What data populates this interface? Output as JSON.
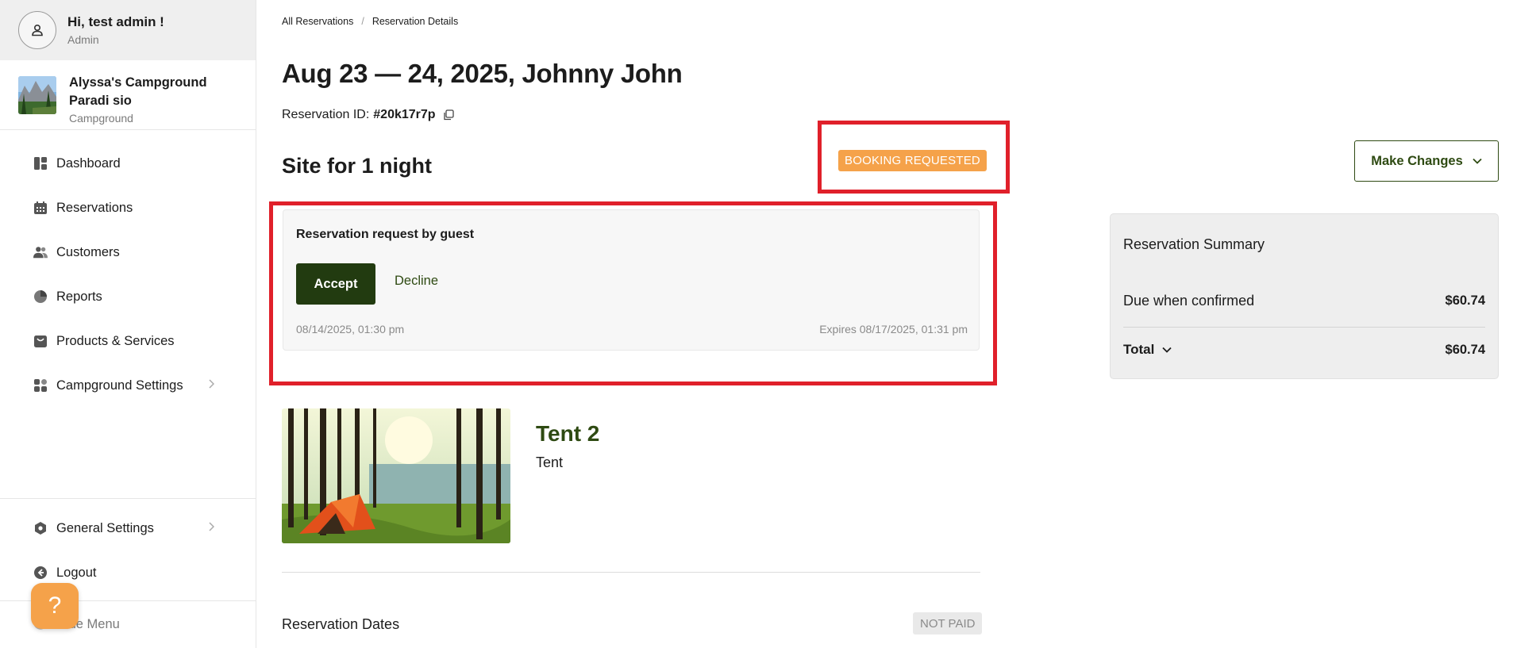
{
  "user": {
    "greeting": "Hi, test admin !",
    "role": "Admin"
  },
  "campground": {
    "name": "Alyssa's Campground Paradi sio",
    "type": "Campground"
  },
  "sidebar": {
    "items": [
      {
        "label": "Dashboard",
        "icon": "dashboard-icon"
      },
      {
        "label": "Reservations",
        "icon": "calendar-icon"
      },
      {
        "label": "Customers",
        "icon": "users-icon"
      },
      {
        "label": "Reports",
        "icon": "pie-chart-icon"
      },
      {
        "label": "Products & Services",
        "icon": "bag-icon"
      },
      {
        "label": "Campground Settings",
        "icon": "apps-icon"
      }
    ],
    "bottom_items": [
      {
        "label": "General Settings",
        "icon": "hexagon-gear-icon"
      },
      {
        "label": "Logout",
        "icon": "logout-icon"
      }
    ],
    "hide_menu": "Hide Menu",
    "help": "?"
  },
  "breadcrumb": {
    "parent": "All Reservations",
    "current": "Reservation Details"
  },
  "page": {
    "title": "Aug 23 — 24, 2025, Johnny John",
    "reservation_id_label": "Reservation ID:",
    "reservation_id": "#20k17r7p",
    "section_title": "Site for 1 night",
    "status": "BOOKING REQUESTED"
  },
  "request": {
    "title": "Reservation request by guest",
    "accept": "Accept",
    "decline": "Decline",
    "requested_at": "08/14/2025, 01:30 pm",
    "expires": "Expires 08/17/2025, 01:31 pm"
  },
  "site": {
    "name": "Tent 2",
    "type": "Tent"
  },
  "dates_section": {
    "title": "Reservation Dates",
    "payment_status": "NOT PAID"
  },
  "actions": {
    "make_changes": "Make Changes"
  },
  "summary": {
    "title": "Reservation Summary",
    "due_label": "Due when confirmed",
    "due_amount": "$60.74",
    "total_label": "Total",
    "total_amount": "$60.74"
  },
  "colors": {
    "accent_green": "#223b10",
    "link_green": "#2e4a12",
    "status_orange": "#f5a24a",
    "highlight_red": "#e0202a"
  }
}
